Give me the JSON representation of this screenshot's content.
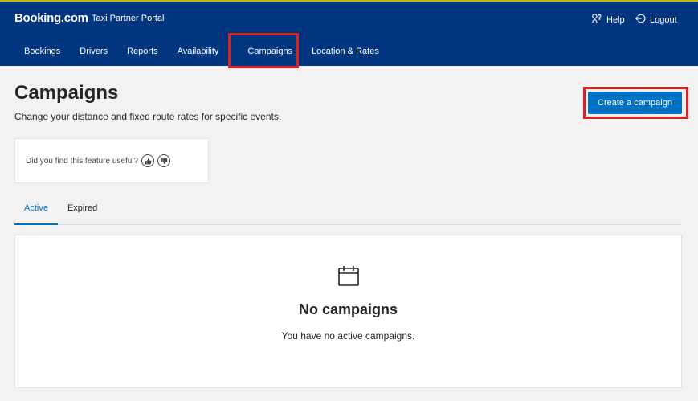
{
  "header": {
    "brand": "Booking.com",
    "portal_name": "Taxi Partner Portal",
    "help_label": "Help",
    "help_icon": "help-icon",
    "logout_label": "Logout",
    "logout_icon": "logout-icon",
    "background_color": "#003580"
  },
  "nav": {
    "items": [
      {
        "label": "Bookings"
      },
      {
        "label": "Drivers"
      },
      {
        "label": "Reports"
      },
      {
        "label": "Availability"
      },
      {
        "label": "Campaigns",
        "active": true
      },
      {
        "label": "Location & Rates"
      }
    ]
  },
  "page": {
    "title": "Campaigns",
    "subtitle": "Change your distance and fixed route rates for specific events.",
    "create_button_label": "Create a campaign",
    "accent_color": "#0071c2"
  },
  "feedback": {
    "question": "Did you find this feature useful?",
    "thumbs_up_icon": "thumbs-up-icon",
    "thumbs_down_icon": "thumbs-down-icon"
  },
  "tabs": [
    {
      "label": "Active",
      "active": true
    },
    {
      "label": "Expired",
      "active": false
    }
  ],
  "empty_state": {
    "icon": "calendar-icon",
    "title": "No campaigns",
    "message": "You have no active campaigns."
  },
  "highlight_color": "#e0201e"
}
